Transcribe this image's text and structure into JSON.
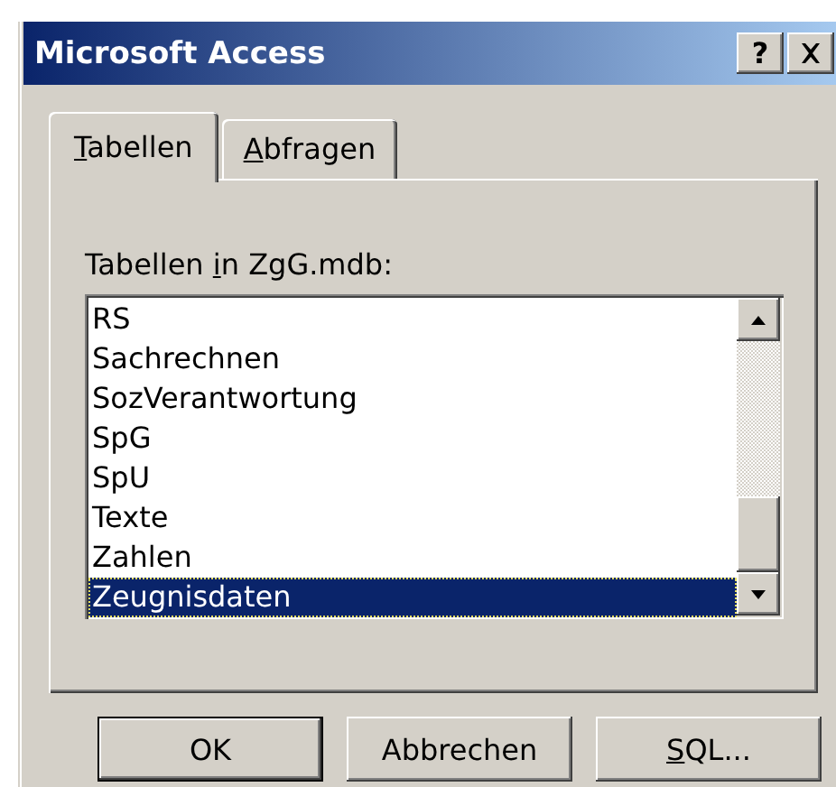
{
  "window": {
    "title": "Microsoft Access",
    "help_button": "?"
  },
  "tabs": [
    {
      "key": "T",
      "post": "abellen",
      "selected": true
    },
    {
      "key": "A",
      "post": "bfragen",
      "selected": false
    }
  ],
  "list_label": {
    "pre": "Tabellen ",
    "key": "i",
    "post": "n ZgG.mdb:"
  },
  "items": [
    {
      "label": "RS",
      "selected": false
    },
    {
      "label": "Sachrechnen",
      "selected": false
    },
    {
      "label": "SozVerantwortung",
      "selected": false
    },
    {
      "label": "SpG",
      "selected": false
    },
    {
      "label": "SpU",
      "selected": false
    },
    {
      "label": "Texte",
      "selected": false
    },
    {
      "label": "Zahlen",
      "selected": false
    },
    {
      "label": "Zeugnisdaten",
      "selected": true
    }
  ],
  "buttons": [
    {
      "post": "OK",
      "default": true
    },
    {
      "post": "Abbrechen",
      "default": false
    },
    {
      "key": "S",
      "post": "QL...",
      "default": false
    }
  ]
}
